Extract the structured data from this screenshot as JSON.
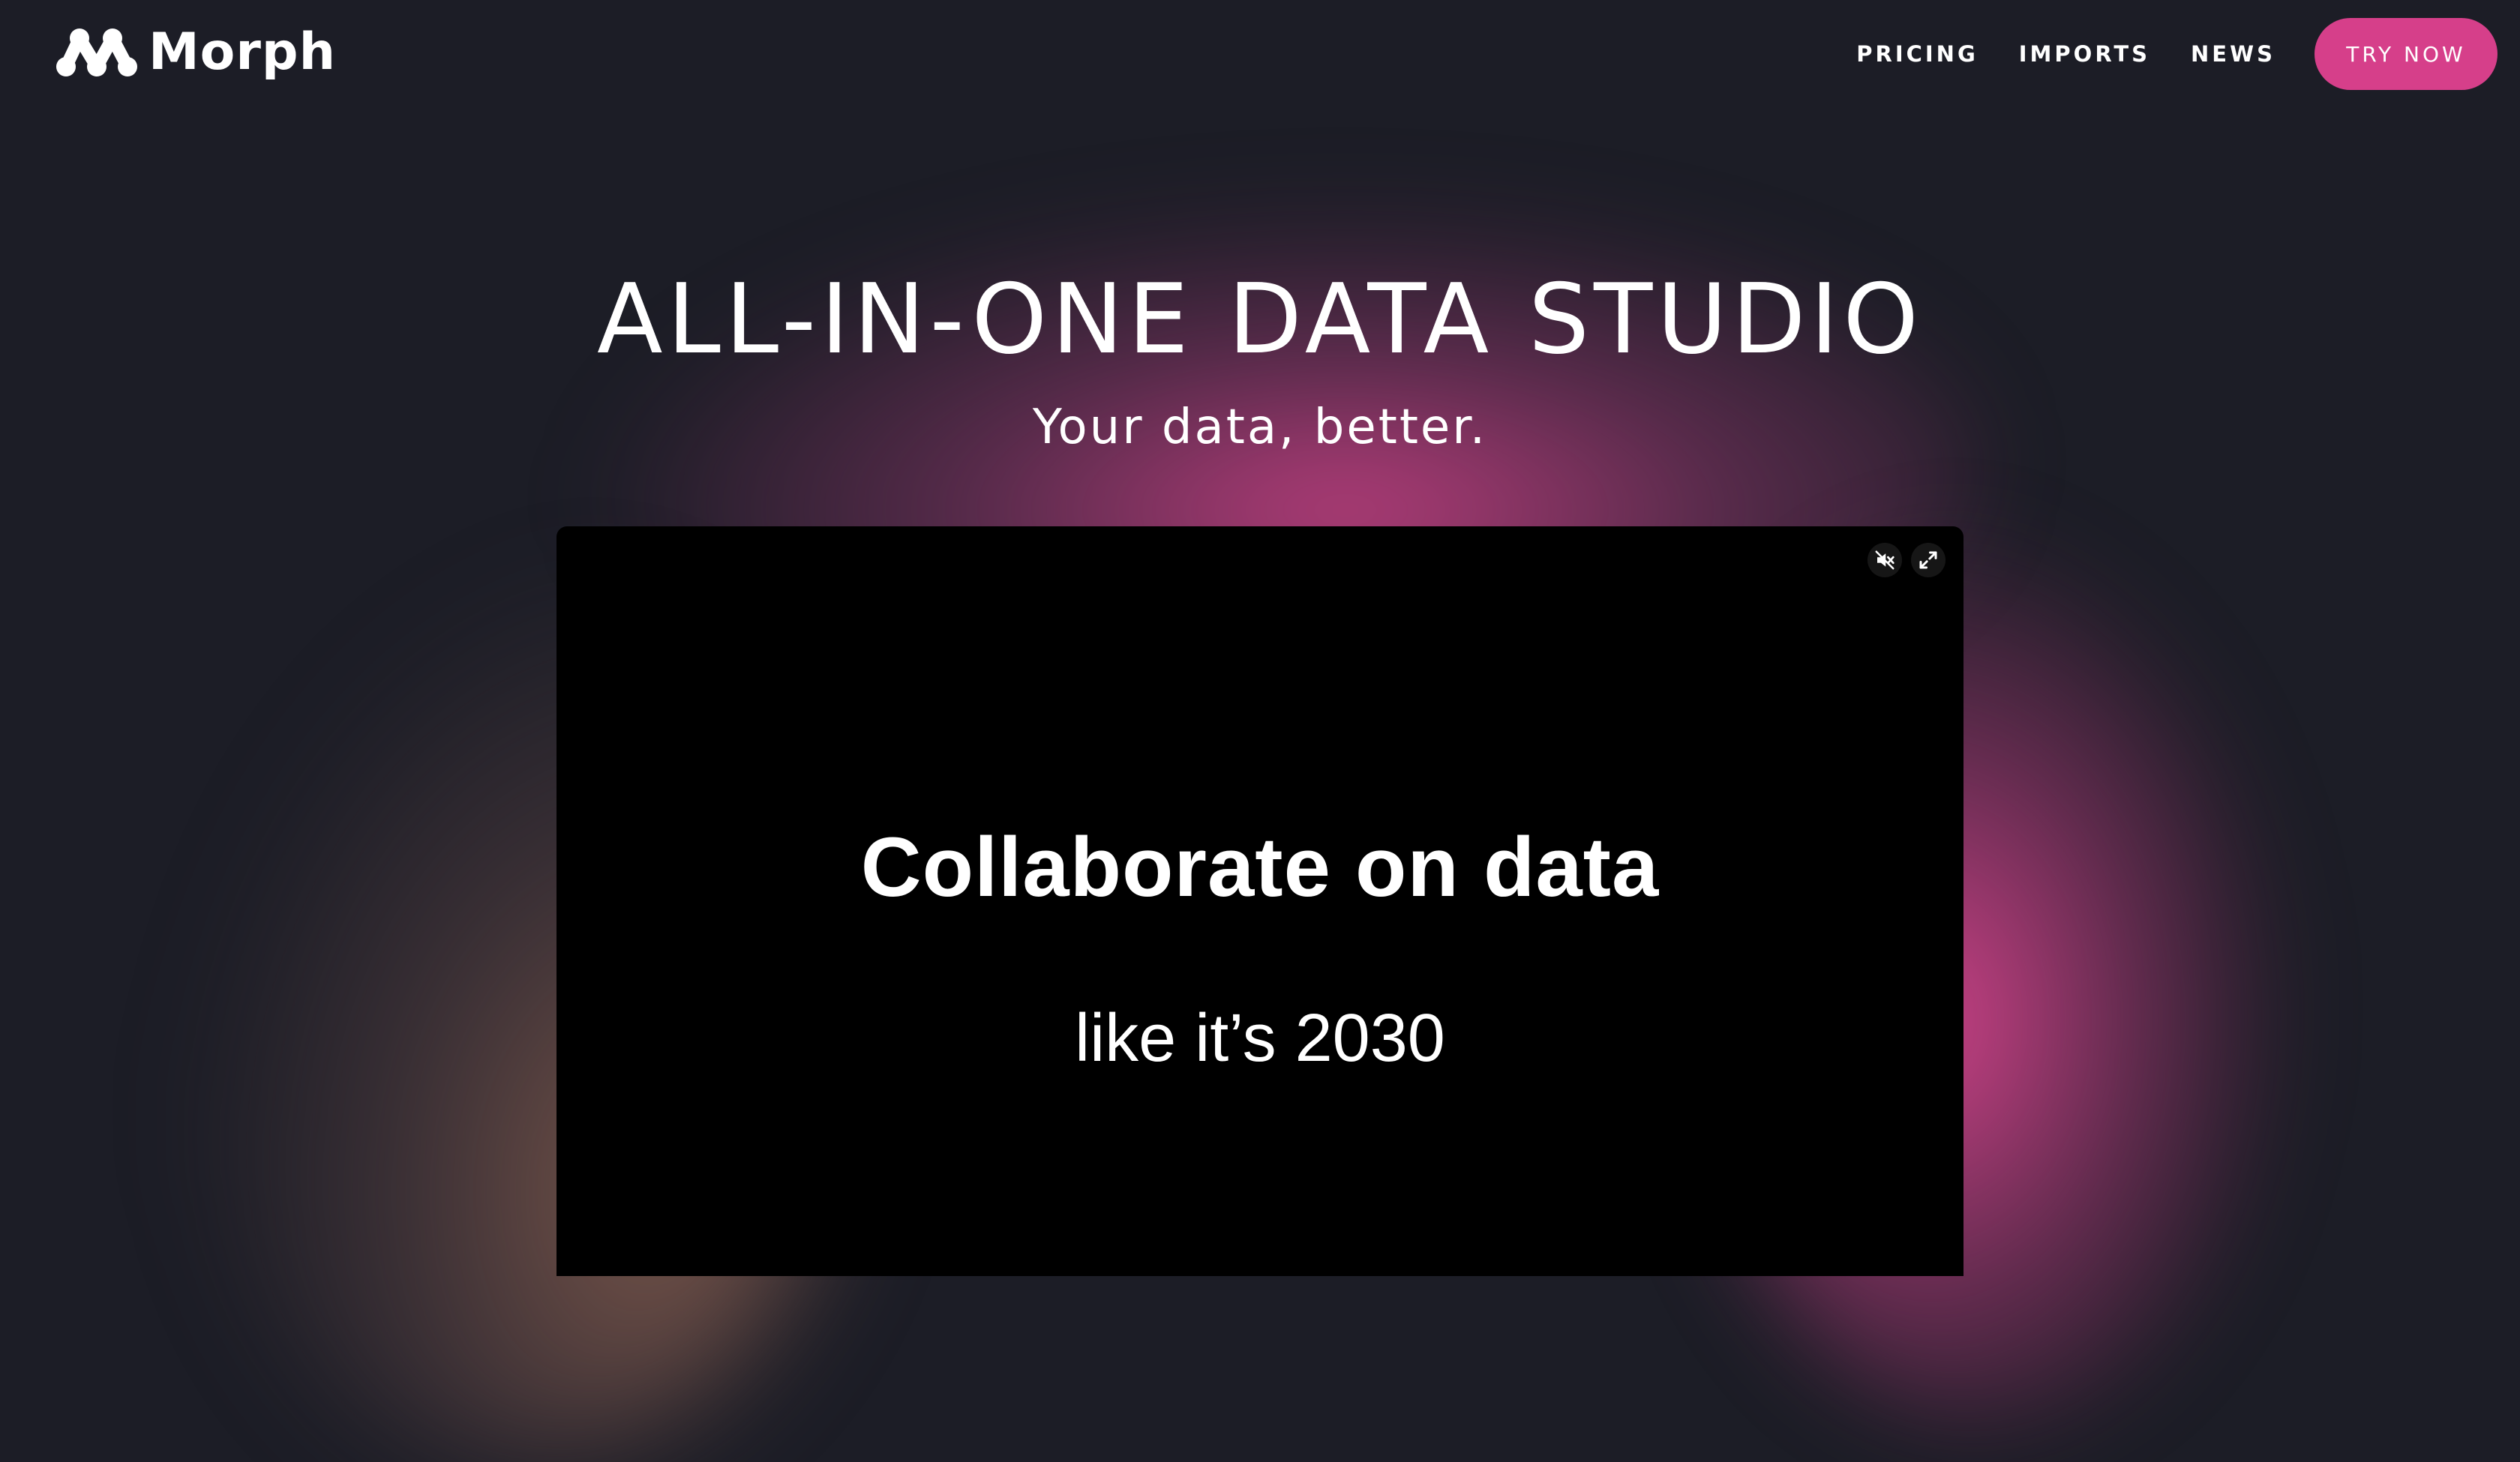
{
  "header": {
    "logo": {
      "icon": "morph-logo-icon",
      "text": "Morph"
    },
    "nav": [
      {
        "label": "PRICING"
      },
      {
        "label": "IMPORTS"
      },
      {
        "label": "NEWS"
      }
    ],
    "cta_label": "TRY NOW"
  },
  "hero": {
    "title": "ALL-IN-ONE DATA STUDIO",
    "subtitle": "Your data, better."
  },
  "video": {
    "headline": "Collaborate on data",
    "subline": "like it’s 2030",
    "controls": [
      {
        "icon": "mute-icon"
      },
      {
        "icon": "fullscreen-icon"
      }
    ]
  },
  "colors": {
    "background": "#1c1d26",
    "accent": "#d63f8a",
    "video_background": "#000000",
    "text": "#ffffff"
  }
}
